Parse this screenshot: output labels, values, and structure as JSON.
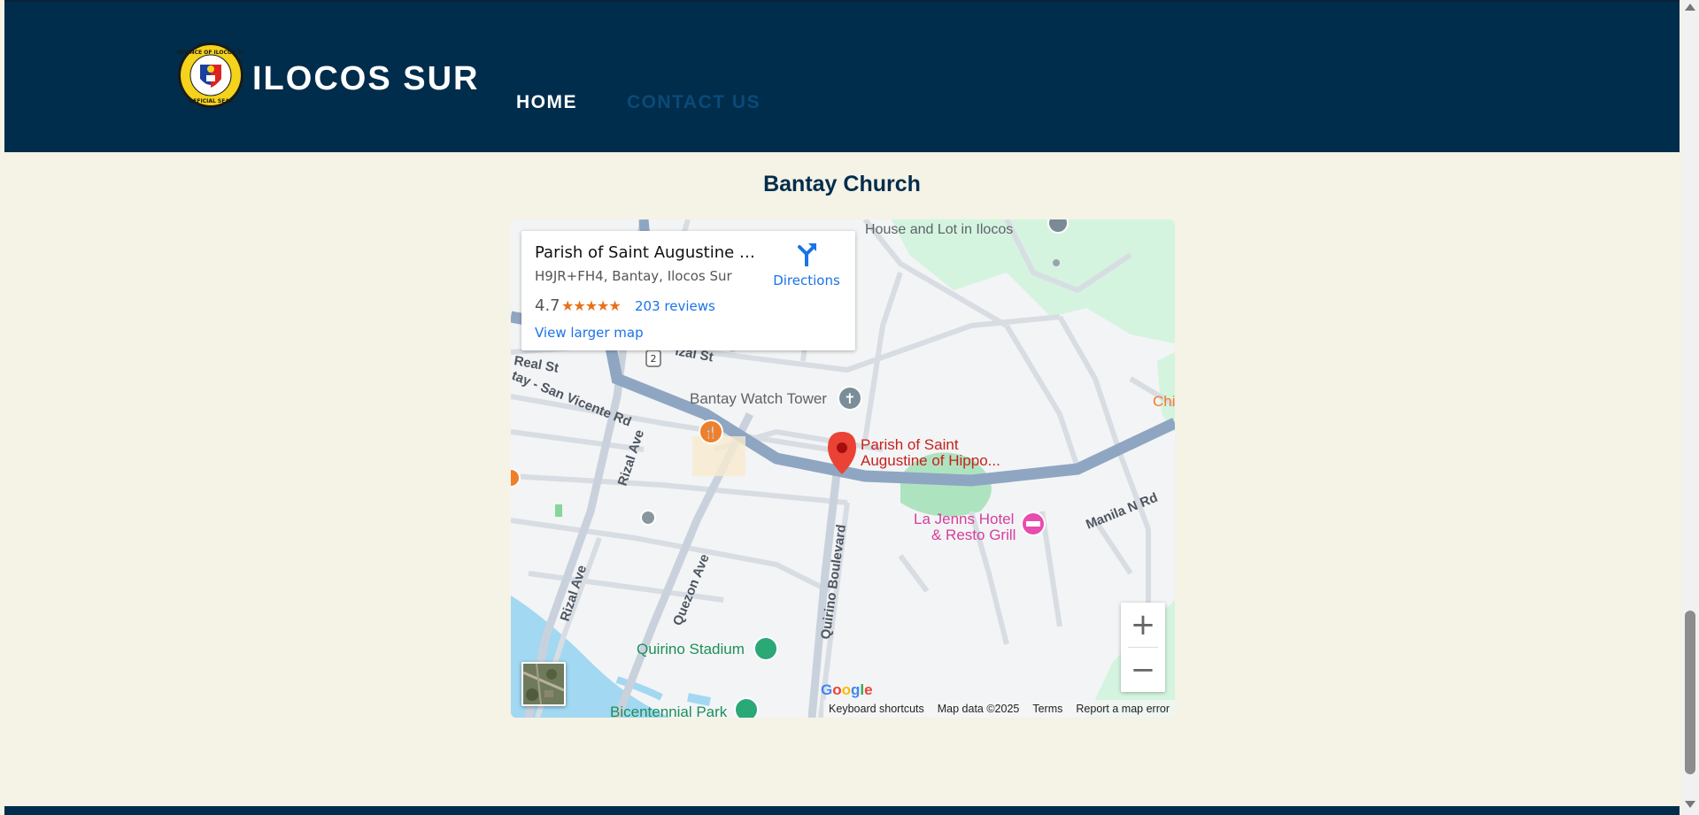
{
  "header": {
    "site_title": "ILOCOS SUR",
    "logo_text": "PROVINCE OF ILOCOS SUR · OFFICIAL SEAL",
    "nav": [
      {
        "label": "HOME",
        "active": true
      },
      {
        "label": "CONTACT US",
        "active": false
      }
    ]
  },
  "section": {
    "title": "Bantay Church"
  },
  "map": {
    "place_card": {
      "name": "Parish of Saint Augustine of H...",
      "address": "H9JR+FH4, Bantay, Ilocos Sur",
      "rating": "4.7",
      "stars": "★★★★★",
      "reviews": "203 reviews",
      "view_larger": "View larger map",
      "directions": "Directions"
    },
    "labels": {
      "house_lot": "House and Lot in Ilocos",
      "watch_tower": "Bantay Watch Tower",
      "parish_line1": "Parish of Saint",
      "parish_line2": "Augustine of Hippo...",
      "hotel_line1": "La Jenns Hotel",
      "hotel_line2": "& Resto Grill",
      "manila_rd": "Manila N Rd",
      "real_st": "Real St",
      "rizal_st": "izal St",
      "san_vicente": "tay - San Vicente Rd",
      "rizal_ave_1": "Rizal Ave",
      "rizal_ave_2": "Rizal Ave",
      "quezon_ave": "Quezon Ave",
      "quirino_blvd": "Quirino Boulevard",
      "quirino_stadium": "Quirino Stadium",
      "bicentennial": "Bicentennial Park",
      "chi": "Chi",
      "route": "2"
    },
    "zoom_in": "+",
    "zoom_out": "−",
    "google": "Google",
    "attribution": [
      "Keyboard shortcuts",
      "Map data ©2025",
      "Terms",
      "Report a map error"
    ]
  },
  "colors": {
    "header_bg": "#002d4c",
    "page_bg": "#f5f2e6",
    "nav_inactive": "#0b4a78",
    "link_blue": "#1a73e8",
    "pin_red": "#ea4335"
  }
}
